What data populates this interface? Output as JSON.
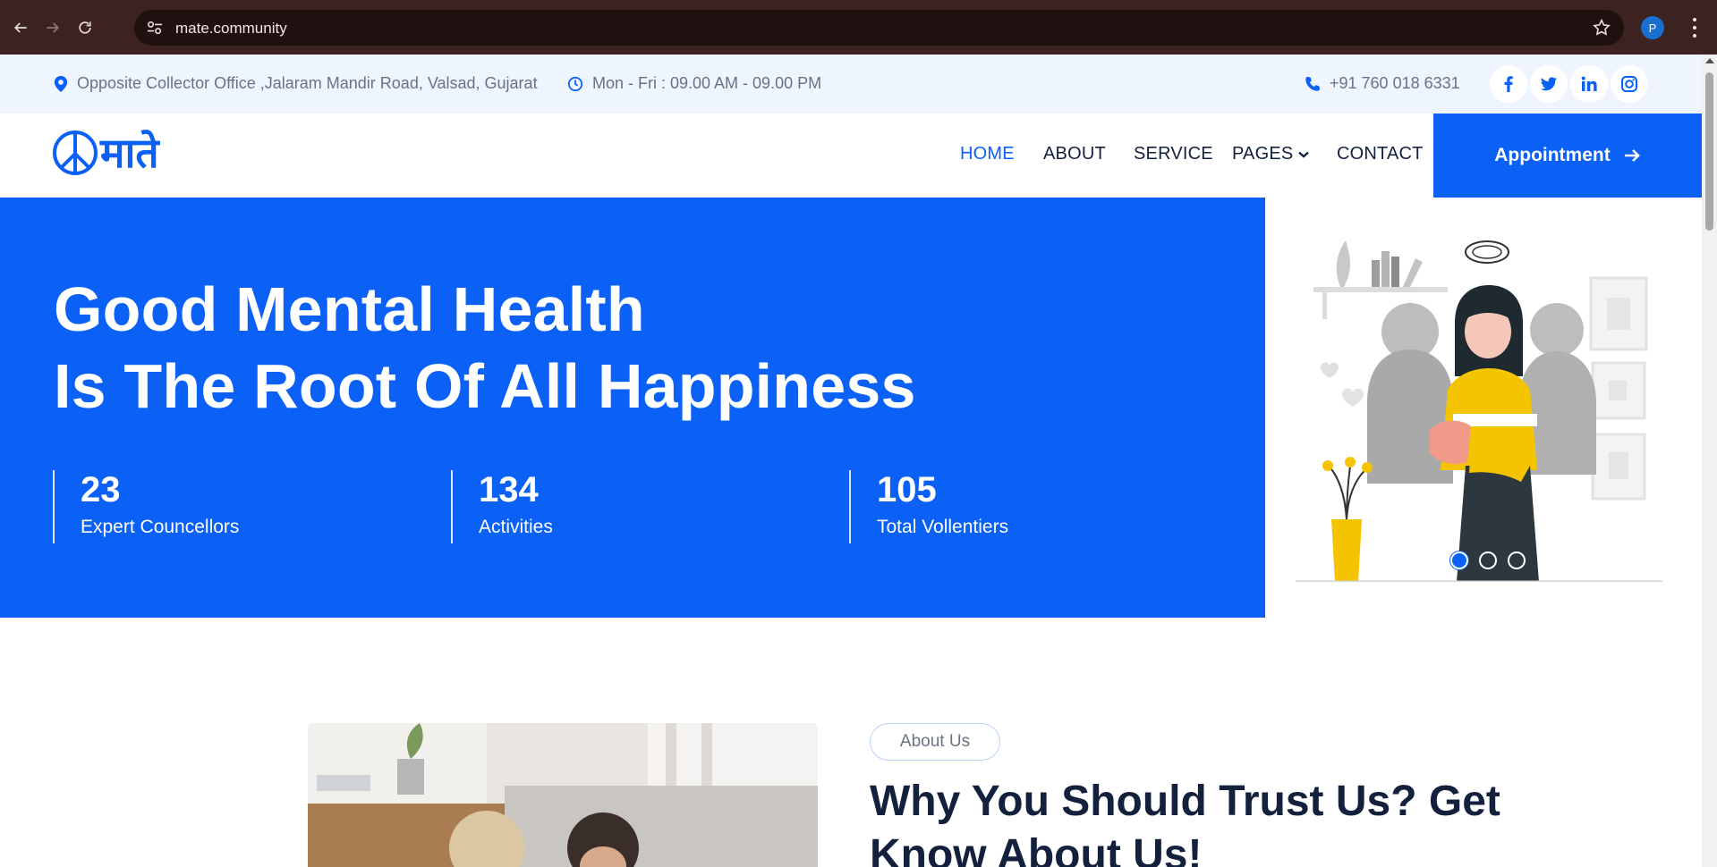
{
  "browser": {
    "url": "mate.community",
    "profile_initial": "P"
  },
  "topbar": {
    "address": "Opposite Collector Office ,Jalaram Mandir Road, Valsad, Gujarat",
    "hours": "Mon - Fri : 09.00 AM - 09.00 PM",
    "phone": "+91 760 018 6331",
    "socials": [
      "facebook-icon",
      "twitter-icon",
      "linkedin-icon",
      "instagram-icon"
    ]
  },
  "logo": {
    "text": "माते"
  },
  "nav": {
    "items": [
      "HOME",
      "ABOUT",
      "SERVICE",
      "PAGES",
      "CONTACT"
    ],
    "active": "HOME",
    "cta": "Appointment"
  },
  "hero": {
    "title_line1": "Good Mental Health",
    "title_line2": "Is The Root Of All Happiness",
    "stats": [
      {
        "value": "23",
        "label": "Expert Councellors"
      },
      {
        "value": "134",
        "label": "Activities"
      },
      {
        "value": "105",
        "label": "Total Vollentiers"
      }
    ],
    "slides_count": 3,
    "active_slide": 1
  },
  "about": {
    "pill": "About Us",
    "title": "Why You Should Trust Us? Get Know About Us!"
  },
  "colors": {
    "brand": "#0b61f5",
    "dark_text": "#14213d",
    "topbar_bg": "#eef5ff",
    "chrome_bg": "#3c2321"
  }
}
